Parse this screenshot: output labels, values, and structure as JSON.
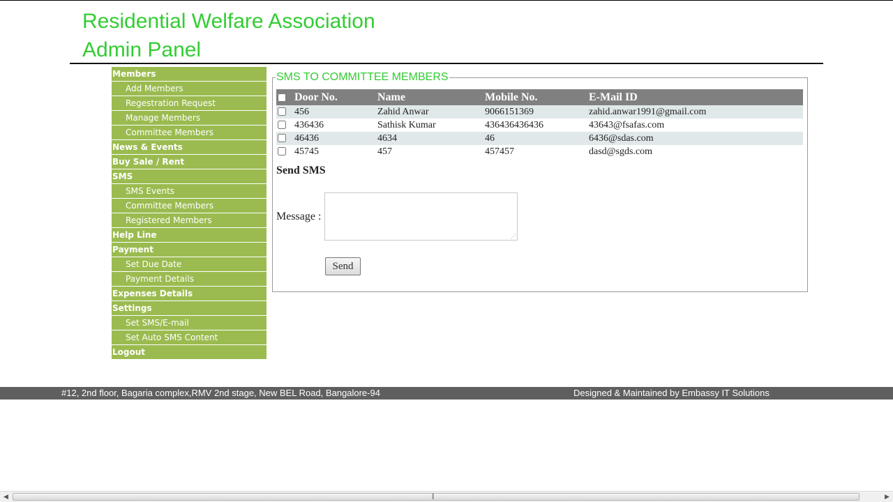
{
  "header": {
    "title_line1": "Residential Welfare Association",
    "title_line2": "Admin Panel",
    "title_color": "#33cc33"
  },
  "sidebar": {
    "accent": "#9bbb50",
    "items": [
      {
        "label": "Members",
        "level": "main"
      },
      {
        "label": "Add Members",
        "level": "sub"
      },
      {
        "label": "Regestration Request",
        "level": "sub"
      },
      {
        "label": "Manage Members",
        "level": "sub"
      },
      {
        "label": "Committee Members",
        "level": "sub"
      },
      {
        "label": "News & Events",
        "level": "main"
      },
      {
        "label": "Buy Sale / Rent",
        "level": "main"
      },
      {
        "label": "SMS",
        "level": "main"
      },
      {
        "label": "SMS Events",
        "level": "sub"
      },
      {
        "label": "Committee Members",
        "level": "sub"
      },
      {
        "label": "Registered Members",
        "level": "sub"
      },
      {
        "label": "Help Line",
        "level": "main"
      },
      {
        "label": "Payment",
        "level": "main"
      },
      {
        "label": "Set Due Date",
        "level": "sub"
      },
      {
        "label": "Payment Details",
        "level": "sub"
      },
      {
        "label": "Expenses Details",
        "level": "main"
      },
      {
        "label": "Settings",
        "level": "main"
      },
      {
        "label": "Set SMS/E-mail",
        "level": "sub"
      },
      {
        "label": "Set Auto SMS Content",
        "level": "sub"
      },
      {
        "label": "Logout",
        "level": "main"
      }
    ]
  },
  "main": {
    "legend": "SMS TO COMMITTEE MEMBERS",
    "table": {
      "headers": [
        "Door No.",
        "Name",
        "Mobile No.",
        "E-Mail ID"
      ],
      "rows": [
        {
          "door": "456",
          "name": "Zahid Anwar",
          "mobile": "9066151369",
          "email": "zahid.anwar1991@gmail.com"
        },
        {
          "door": "436436",
          "name": "Sathisk Kumar",
          "mobile": "436436436436",
          "email": "43643@fsafas.com"
        },
        {
          "door": "46436",
          "name": "4634",
          "mobile": "46",
          "email": "6436@sdas.com"
        },
        {
          "door": "45745",
          "name": "457",
          "mobile": "457457",
          "email": "dasd@sgds.com"
        }
      ]
    },
    "send_heading": "Send SMS",
    "message_label": "Message :",
    "message_value": "",
    "send_button": "Send"
  },
  "footer": {
    "address": "#12, 2nd floor, Bagaria complex,RMV 2nd stage, New BEL Road, Bangalore-94",
    "credit": "Designed & Maintained by Embassy IT Solutions"
  }
}
